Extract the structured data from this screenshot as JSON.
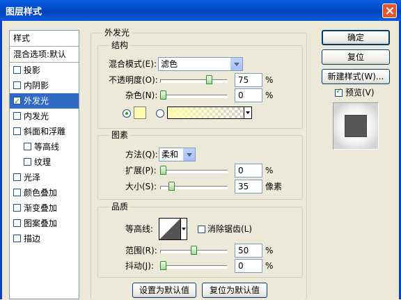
{
  "window": {
    "title": "图层样式"
  },
  "sidebar": {
    "header": "样式",
    "blend_options": "混合选项:默认",
    "items": [
      {
        "label": "投影",
        "checked": false,
        "selected": false,
        "indent": false
      },
      {
        "label": "内阴影",
        "checked": false,
        "selected": false,
        "indent": false
      },
      {
        "label": "外发光",
        "checked": true,
        "selected": true,
        "indent": false
      },
      {
        "label": "内发光",
        "checked": false,
        "selected": false,
        "indent": false
      },
      {
        "label": "斜面和浮雕",
        "checked": false,
        "selected": false,
        "indent": false
      },
      {
        "label": "等高线",
        "checked": false,
        "selected": false,
        "indent": true
      },
      {
        "label": "纹理",
        "checked": false,
        "selected": false,
        "indent": true
      },
      {
        "label": "光泽",
        "checked": false,
        "selected": false,
        "indent": false
      },
      {
        "label": "颜色叠加",
        "checked": false,
        "selected": false,
        "indent": false
      },
      {
        "label": "渐变叠加",
        "checked": false,
        "selected": false,
        "indent": false
      },
      {
        "label": "图案叠加",
        "checked": false,
        "selected": false,
        "indent": false
      },
      {
        "label": "描边",
        "checked": false,
        "selected": false,
        "indent": false
      }
    ]
  },
  "outer_glow": {
    "title": "外发光",
    "structure": {
      "title": "结构",
      "blend_mode_label": "混合模式(E):",
      "blend_mode_value": "滤色",
      "opacity_label": "不透明度(O):",
      "opacity_value": "75",
      "opacity_unit": "%",
      "opacity_level": 0.75,
      "noise_label": "杂色(N):",
      "noise_value": "0",
      "noise_unit": "%",
      "noise_level": 0,
      "glow_color": "#fffbb0",
      "color_radio_selected": true,
      "gradient_radio_selected": false
    },
    "elements": {
      "title": "图素",
      "technique_label": "方法(Q):",
      "technique_value": "柔和",
      "spread_label": "扩展(P):",
      "spread_value": "0",
      "spread_unit": "%",
      "spread_level": 0,
      "size_label": "大小(S):",
      "size_value": "35",
      "size_unit": "像素",
      "size_level": 0.14
    },
    "quality": {
      "title": "品质",
      "contour_label": "等高线:",
      "antialias_label": "消除锯齿(L)",
      "antialias_checked": false,
      "range_label": "范围(R):",
      "range_value": "50",
      "range_unit": "%",
      "range_level": 0.5,
      "jitter_label": "抖动(J):",
      "jitter_value": "0",
      "jitter_unit": "%",
      "jitter_level": 0
    },
    "make_default": "设置为默认值",
    "reset_default": "复位为默认值"
  },
  "buttons": {
    "ok": "确定",
    "reset": "复位",
    "new_style": "新建样式(W)...",
    "preview_label": "预览(V)",
    "preview_checked": true
  }
}
